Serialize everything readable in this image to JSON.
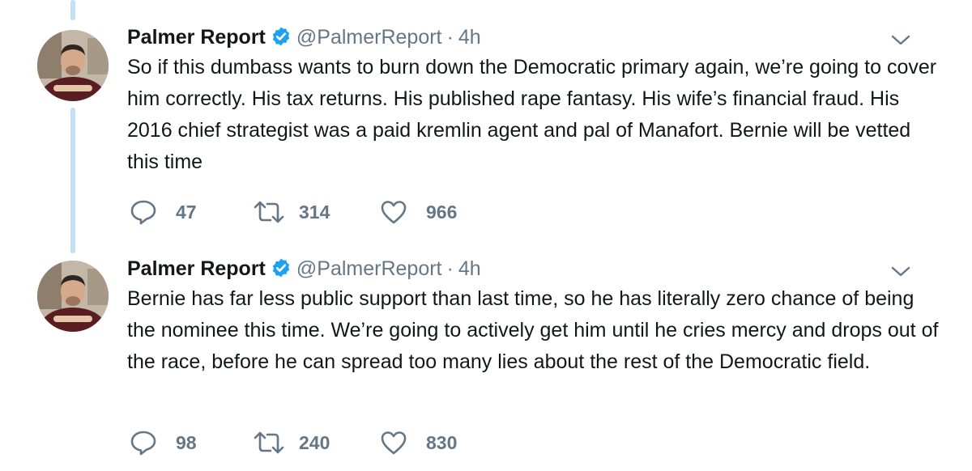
{
  "colors": {
    "accent": "#1da1f2",
    "thread_line": "#c4def3",
    "secondary_text": "#657786",
    "primary_text": "#14171a"
  },
  "tweets": [
    {
      "author_name": "Palmer Report",
      "handle": "@PalmerReport",
      "separator": "·",
      "time": "4h",
      "verified": true,
      "text": "So if this dumbass wants to burn down the Democratic primary again, we’re going to cover him correctly. His tax returns. His published rape fantasy. His wife’s financial fraud. His 2016 chief strategist was a paid kremlin agent and pal of Manafort. Bernie will be vetted this time",
      "replies": "47",
      "retweets": "314",
      "likes": "966"
    },
    {
      "author_name": "Palmer Report",
      "handle": "@PalmerReport",
      "separator": "·",
      "time": "4h",
      "verified": true,
      "text": "Bernie has far less public support than last time, so he has literally zero chance of being the nominee this time. We’re going to actively get him until he cries mercy and drops out of the race, before he can spread too many lies about the rest of the Democratic field.",
      "replies": "98",
      "retweets": "240",
      "likes": "830"
    }
  ],
  "icons": {
    "verified": "verified-badge-icon",
    "caret": "chevron-down-icon",
    "reply": "reply-icon",
    "retweet": "retweet-icon",
    "like": "heart-icon"
  }
}
